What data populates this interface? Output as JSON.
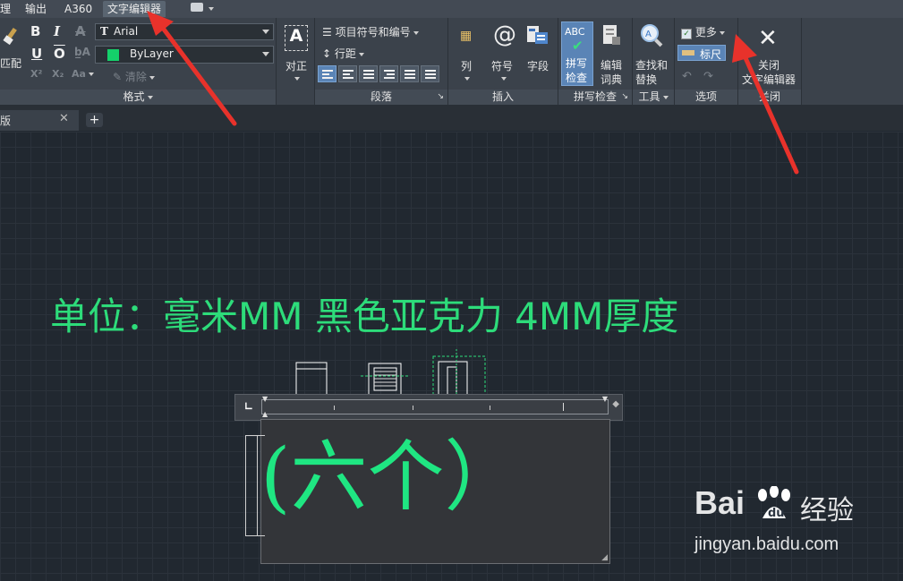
{
  "ribbon_tabs": [
    "理",
    "输出",
    "A360",
    "文字编辑器"
  ],
  "format": {
    "match_label": "匹配",
    "font_value": "Arial",
    "color_value": "ByLayer",
    "clear_label": "清除",
    "title": "格式"
  },
  "paragraph": {
    "justify_label": "对正",
    "bullets_label": "项目符号和编号",
    "line_spacing_label": "行距",
    "title": "段落"
  },
  "insert": {
    "columns_label": "列",
    "symbol_label": "符号",
    "field_label": "字段",
    "title": "插入"
  },
  "spell": {
    "spellcheck_label": "拼写\n检查",
    "dict_label": "编辑\n词典",
    "title": "拼写检查"
  },
  "tools": {
    "find_label": "查找和\n替换",
    "title": "工具"
  },
  "options": {
    "more_label": "更多",
    "ruler_label": "标尺",
    "title": "选项"
  },
  "close": {
    "close_label": "关闭\n文字编辑器",
    "title": "关闭"
  },
  "doc_tab": "版",
  "drawing": {
    "unit_text": "单位：毫米MM 黑色亚克力 4MM厚度",
    "edit_text": "(六个）"
  },
  "watermark": {
    "brand": "Bai",
    "brand2": "经验",
    "url": "jingyan.baidu.com"
  },
  "colors": {
    "accent_green": "#2ddc7a",
    "arrow_red": "#e8322b",
    "active_blue": "#5a84b6"
  }
}
